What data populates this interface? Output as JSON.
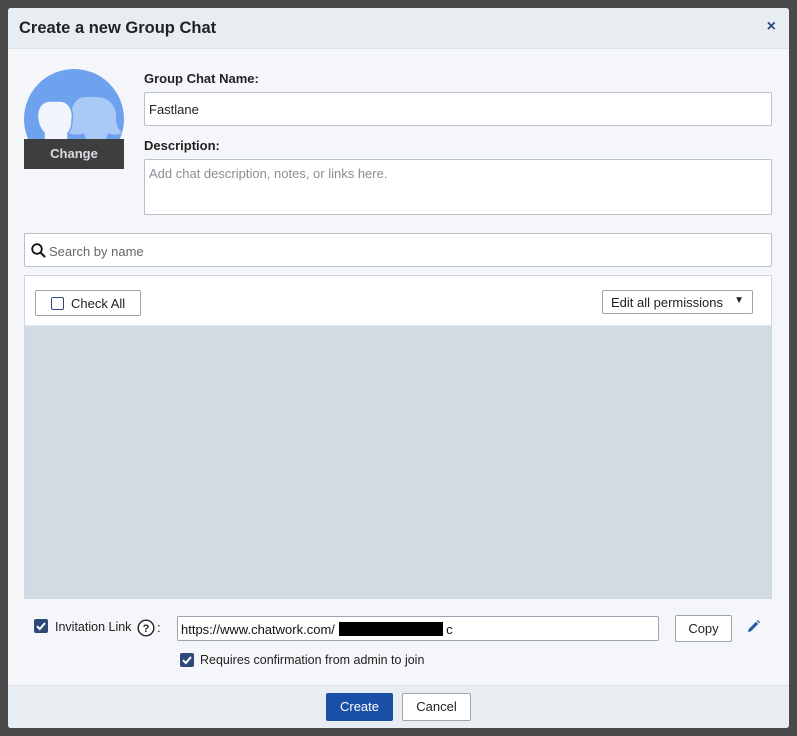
{
  "dialog": {
    "title": "Create a new Group Chat",
    "close_label": "×"
  },
  "avatar": {
    "change_label": "Change"
  },
  "form": {
    "name_label": "Group Chat Name:",
    "name_value": "Fastlane",
    "description_label": "Description:",
    "description_placeholder": "Add chat description, notes, or links here."
  },
  "search": {
    "placeholder": "Search by name"
  },
  "members": {
    "check_all_label": "Check All",
    "edit_permissions_label": "Edit all permissions",
    "caret": "▼"
  },
  "invitation": {
    "enabled": true,
    "label": "Invitation Link",
    "colon": ":",
    "link_prefix": "https://www.chatwork.com/",
    "link_suffix": "c",
    "copy_label": "Copy",
    "confirm_enabled": true,
    "confirm_label": "Requires confirmation from admin to join"
  },
  "footer": {
    "create_label": "Create",
    "cancel_label": "Cancel"
  },
  "colors": {
    "primary": "#1a4fa8",
    "checkbox": "#2b4a7a",
    "avatar": "#6ea2ef",
    "members_bg": "#d1dbe3"
  }
}
